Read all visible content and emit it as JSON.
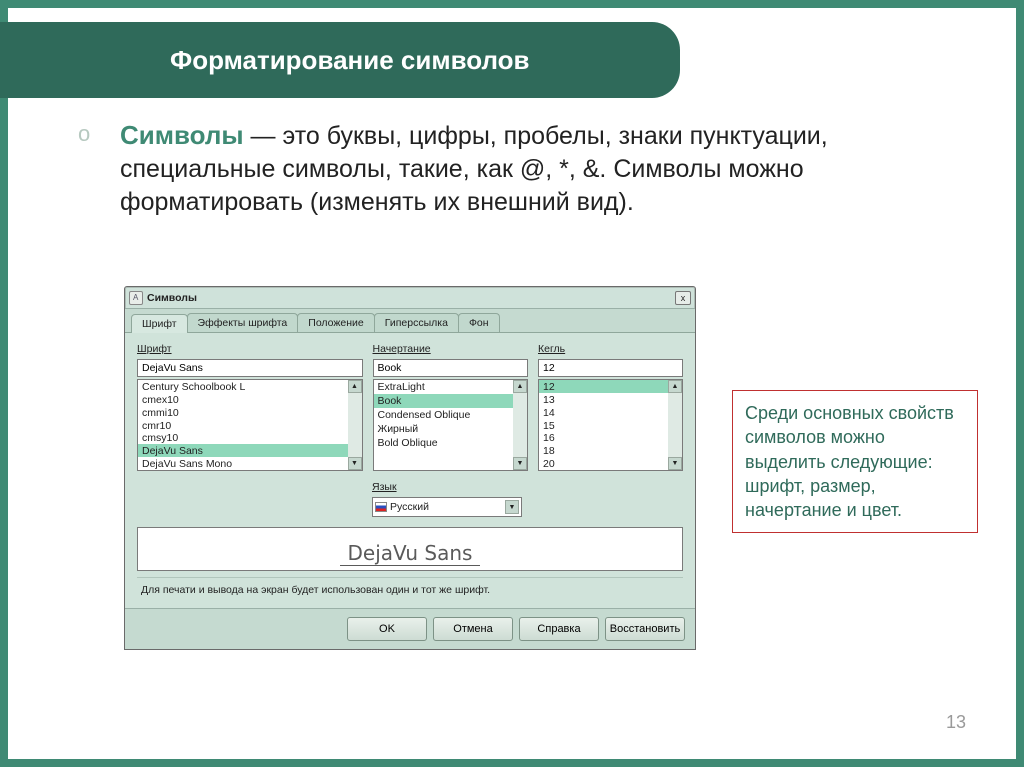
{
  "slide": {
    "title": "Форматирование символов",
    "bullet_mark": "o",
    "para_strong": "Символы",
    "para_rest": " — это буквы, цифры, пробелы, знаки пунктуации, специальные символы, такие, как @, *, &. Символы можно форматировать (изменять их внешний вид).",
    "side_note": "Среди основных свойств символов можно выделить следующие: шрифт, размер, начертание и цвет.",
    "page_number": "13"
  },
  "dialog": {
    "title": "Символы",
    "close": "x",
    "tabs": {
      "font": "Шрифт",
      "effects": "Эффекты шрифта",
      "position": "Положение",
      "hyperlink": "Гиперссылка",
      "background": "Фон"
    },
    "labels": {
      "font": "Шрифт",
      "style": "Начертание",
      "size": "Кегль",
      "language": "Язык"
    },
    "font": {
      "value": "DejaVu Sans",
      "items": [
        "Century Schoolbook L",
        "cmex10",
        "cmmi10",
        "cmr10",
        "cmsy10",
        "DejaVu Sans",
        "DejaVu Sans Mono"
      ],
      "selected_index": 5
    },
    "style": {
      "value": "Book",
      "items": [
        "ExtraLight",
        "Book",
        "Condensed Oblique",
        "Жирный",
        "Bold Oblique"
      ],
      "selected_index": 1
    },
    "size": {
      "value": "12",
      "items": [
        "12",
        "13",
        "14",
        "15",
        "16",
        "18",
        "20"
      ],
      "selected_index": 0
    },
    "language": {
      "value": "Русский"
    },
    "preview": "DejaVu Sans",
    "hint": "Для печати и вывода на экран будет использован один и тот же шрифт.",
    "buttons": {
      "ok": "OK",
      "cancel": "Отмена",
      "help": "Справка",
      "reset": "Восстановить"
    },
    "scroll": {
      "up": "▲",
      "down": "▼"
    }
  }
}
